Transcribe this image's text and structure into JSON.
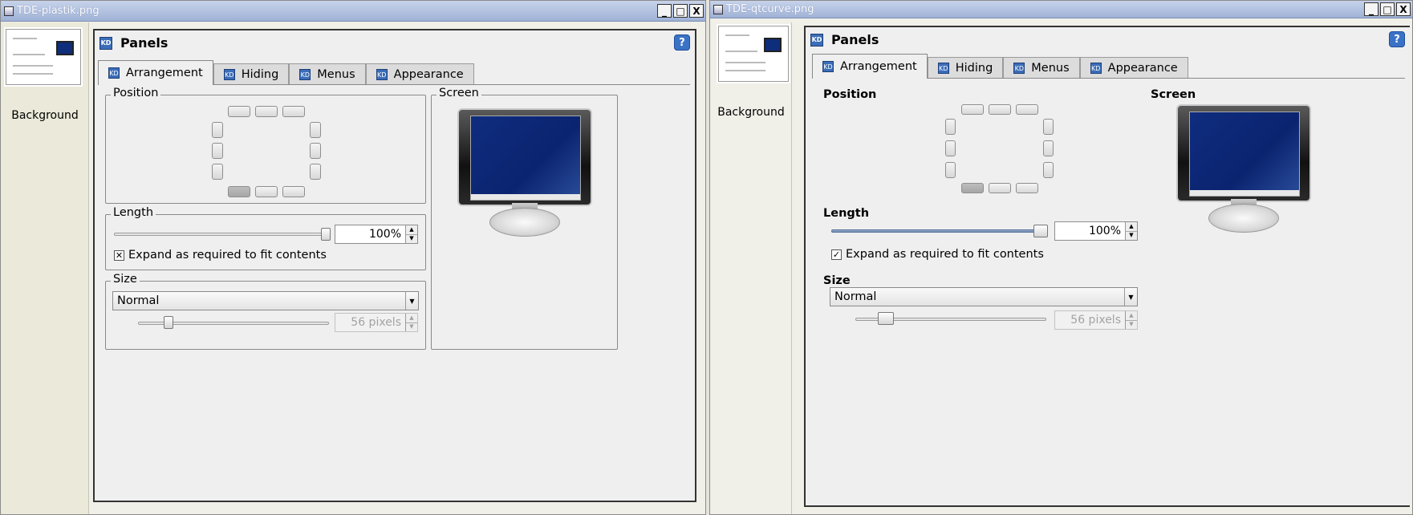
{
  "windows": [
    {
      "title": "TDE-plastik.png",
      "sidebar_label": "Background",
      "header_title": "Panels",
      "help_label": "?",
      "tabs": [
        "Arrangement",
        "Hiding",
        "Menus",
        "Appearance"
      ],
      "position_label": "Position",
      "screen_label": "Screen",
      "length_label": "Length",
      "length_value": "100%",
      "length_level": 1.0,
      "expand_label": "Expand as required to fit contents",
      "expand_checked": true,
      "size_label": "Size",
      "size_value": "Normal",
      "pixels_value": "56 pixels"
    },
    {
      "title": "TDE-qtcurve.png",
      "sidebar_label": "Background",
      "header_title": "Panels",
      "help_label": "?",
      "tabs": [
        "Arrangement",
        "Hiding",
        "Menus",
        "Appearance"
      ],
      "position_label": "Position",
      "screen_label": "Screen",
      "length_label": "Length",
      "length_value": "100%",
      "length_level": 1.0,
      "expand_label": "Expand as required to fit contents",
      "expand_checked": true,
      "size_label": "Size",
      "size_value": "Normal",
      "pixels_value": "56 pixels"
    }
  ],
  "window_buttons": {
    "minimize": "_",
    "maximize": "□",
    "close": "X"
  },
  "icons": {
    "app": "image-icon",
    "section": "kde-config-icon",
    "help": "help-icon"
  },
  "colors": {
    "titlebar": "#9fb2d6",
    "screen": "#0f2c7e",
    "selected_position": "#a6a6a6"
  }
}
